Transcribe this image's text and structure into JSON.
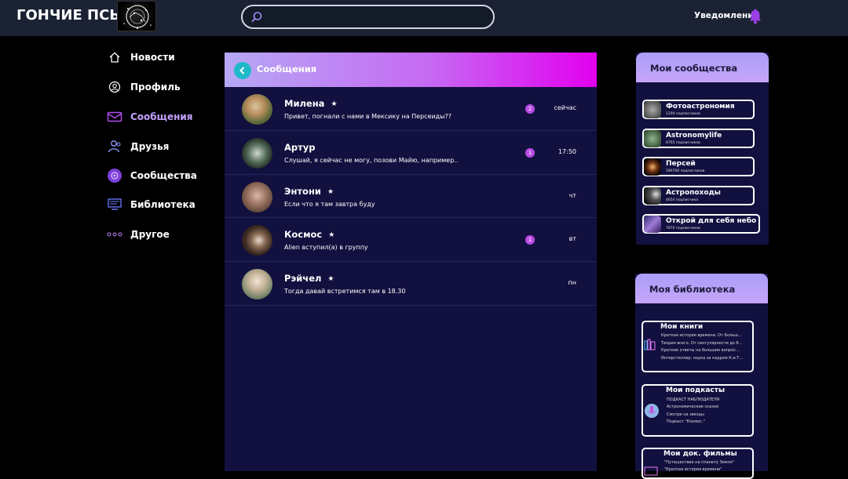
{
  "header": {
    "brand": "ГОНЧИЕ ПСЫ",
    "search_placeholder": "",
    "notifications_label": "Уведомления"
  },
  "nav": {
    "items": [
      {
        "label": "Новости",
        "icon": "home-icon"
      },
      {
        "label": "Профиль",
        "icon": "user-icon"
      },
      {
        "label": "Сообщения",
        "icon": "messages-icon"
      },
      {
        "label": "Друзья",
        "icon": "friends-icon"
      },
      {
        "label": "Сообщества",
        "icon": "communities-icon"
      },
      {
        "label": "Библиотека",
        "icon": "library-icon"
      },
      {
        "label": "Другое",
        "icon": "more-icon"
      }
    ]
  },
  "messages": {
    "title": "Сообщения",
    "rows": [
      {
        "name": "Милена",
        "starred": true,
        "preview": "Привет, погнали с нами в Мексику на Персеиды??",
        "unread": "2",
        "time": "сейчас"
      },
      {
        "name": "Артур",
        "starred": false,
        "preview": "Слушай, я сейчас не могу, позови Майю, например..",
        "unread": "1",
        "time": "17:50"
      },
      {
        "name": "Энтони",
        "starred": true,
        "preview": "Если что я там завтра буду",
        "unread": "",
        "time": "чт"
      },
      {
        "name": "Космос",
        "starred": true,
        "preview": "Alien вступил(а) в группу",
        "unread": "1",
        "time": "вт"
      },
      {
        "name": "Рэйчел",
        "starred": true,
        "preview": "Тогда давай встретимся там в 18.30",
        "unread": "",
        "time": "пн"
      }
    ]
  },
  "communities": {
    "title": "Мои сообщества",
    "items": [
      {
        "name": "Фотоастрономия",
        "subs": "1200 подписчиков"
      },
      {
        "name": "Astronomylife",
        "subs": "8765 подписчиков"
      },
      {
        "name": "Персей",
        "subs": "589760 подписчиков"
      },
      {
        "name": "Астропоходы",
        "subs": "4654 подписчика"
      },
      {
        "name": "Открой для себя небо",
        "subs": "7870 подписчиков"
      }
    ]
  },
  "library": {
    "title": "Моя библиотека",
    "sections": [
      {
        "title": "Мои книги",
        "icon": "books-icon",
        "items": [
          "Краткая история времени. От Больш...",
          "Теория всего. От сингулярности до б...",
          "Краткие ответы на большие вопрос...",
          "Интерстеллар: наука за кадром К.и.Т..."
        ]
      },
      {
        "title": "Мои подкасты",
        "icon": "podcast-icon",
        "items": [
          "ПОДКАСТ НАБЛЮДАТЕЛЯ",
          "Астрономические сказки",
          "Смотри на звезды",
          "Подкаст \"Космос.\""
        ]
      },
      {
        "title": "Мои док. фильмы",
        "icon": "film-icon",
        "items": [
          "\"Путешествие на планету Земля\"",
          "\"Краткая история времени\""
        ]
      }
    ]
  },
  "colors": {
    "accent": "#c66af3",
    "back_button": "#1fb9c9",
    "badge": "#b94be4",
    "panel_bg": "#12103f",
    "topbar_bg": "#1a2233"
  }
}
